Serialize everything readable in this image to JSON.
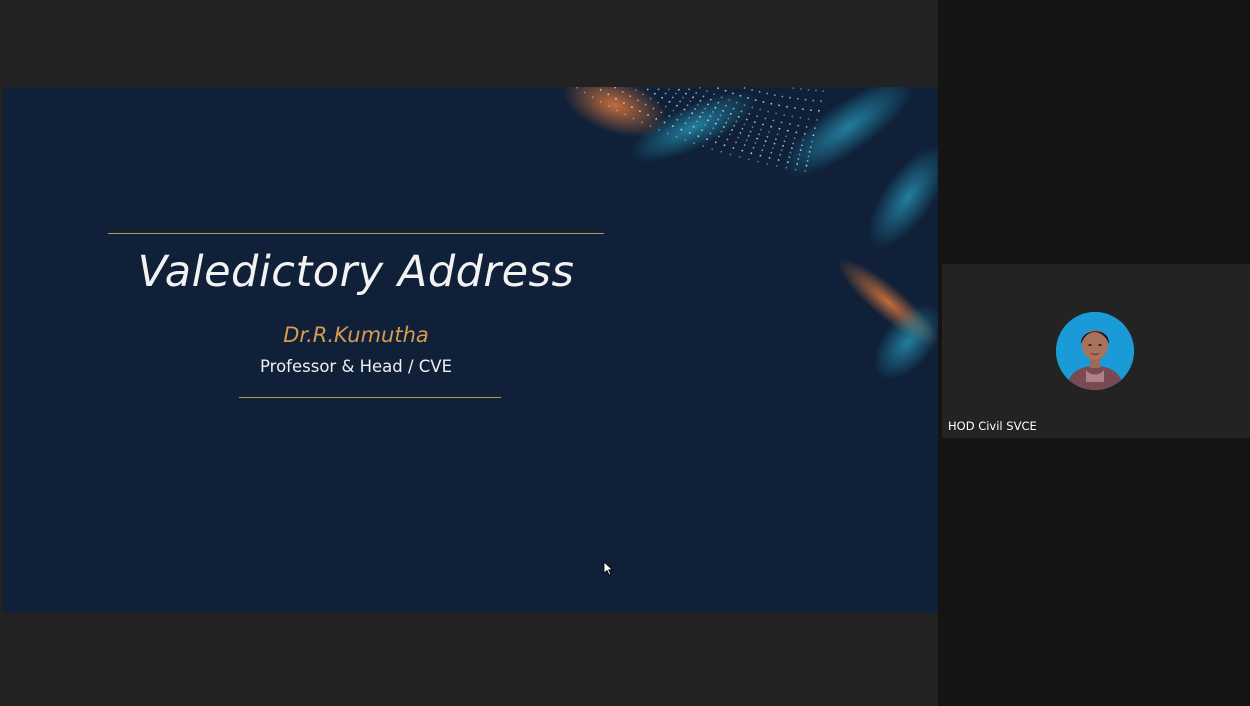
{
  "slide": {
    "title": "Valedictory Address",
    "presenter_name": "Dr.R.Kumutha",
    "presenter_role": "Professor & Head / CVE"
  },
  "participant": {
    "name": "HOD Civil SVCE"
  },
  "colors": {
    "slide_background": "#0f2038",
    "accent_gold": "#c4954f",
    "name_orange": "#d89a4e",
    "avatar_blue": "#1a9ad6",
    "app_background": "#1e1e1e"
  }
}
